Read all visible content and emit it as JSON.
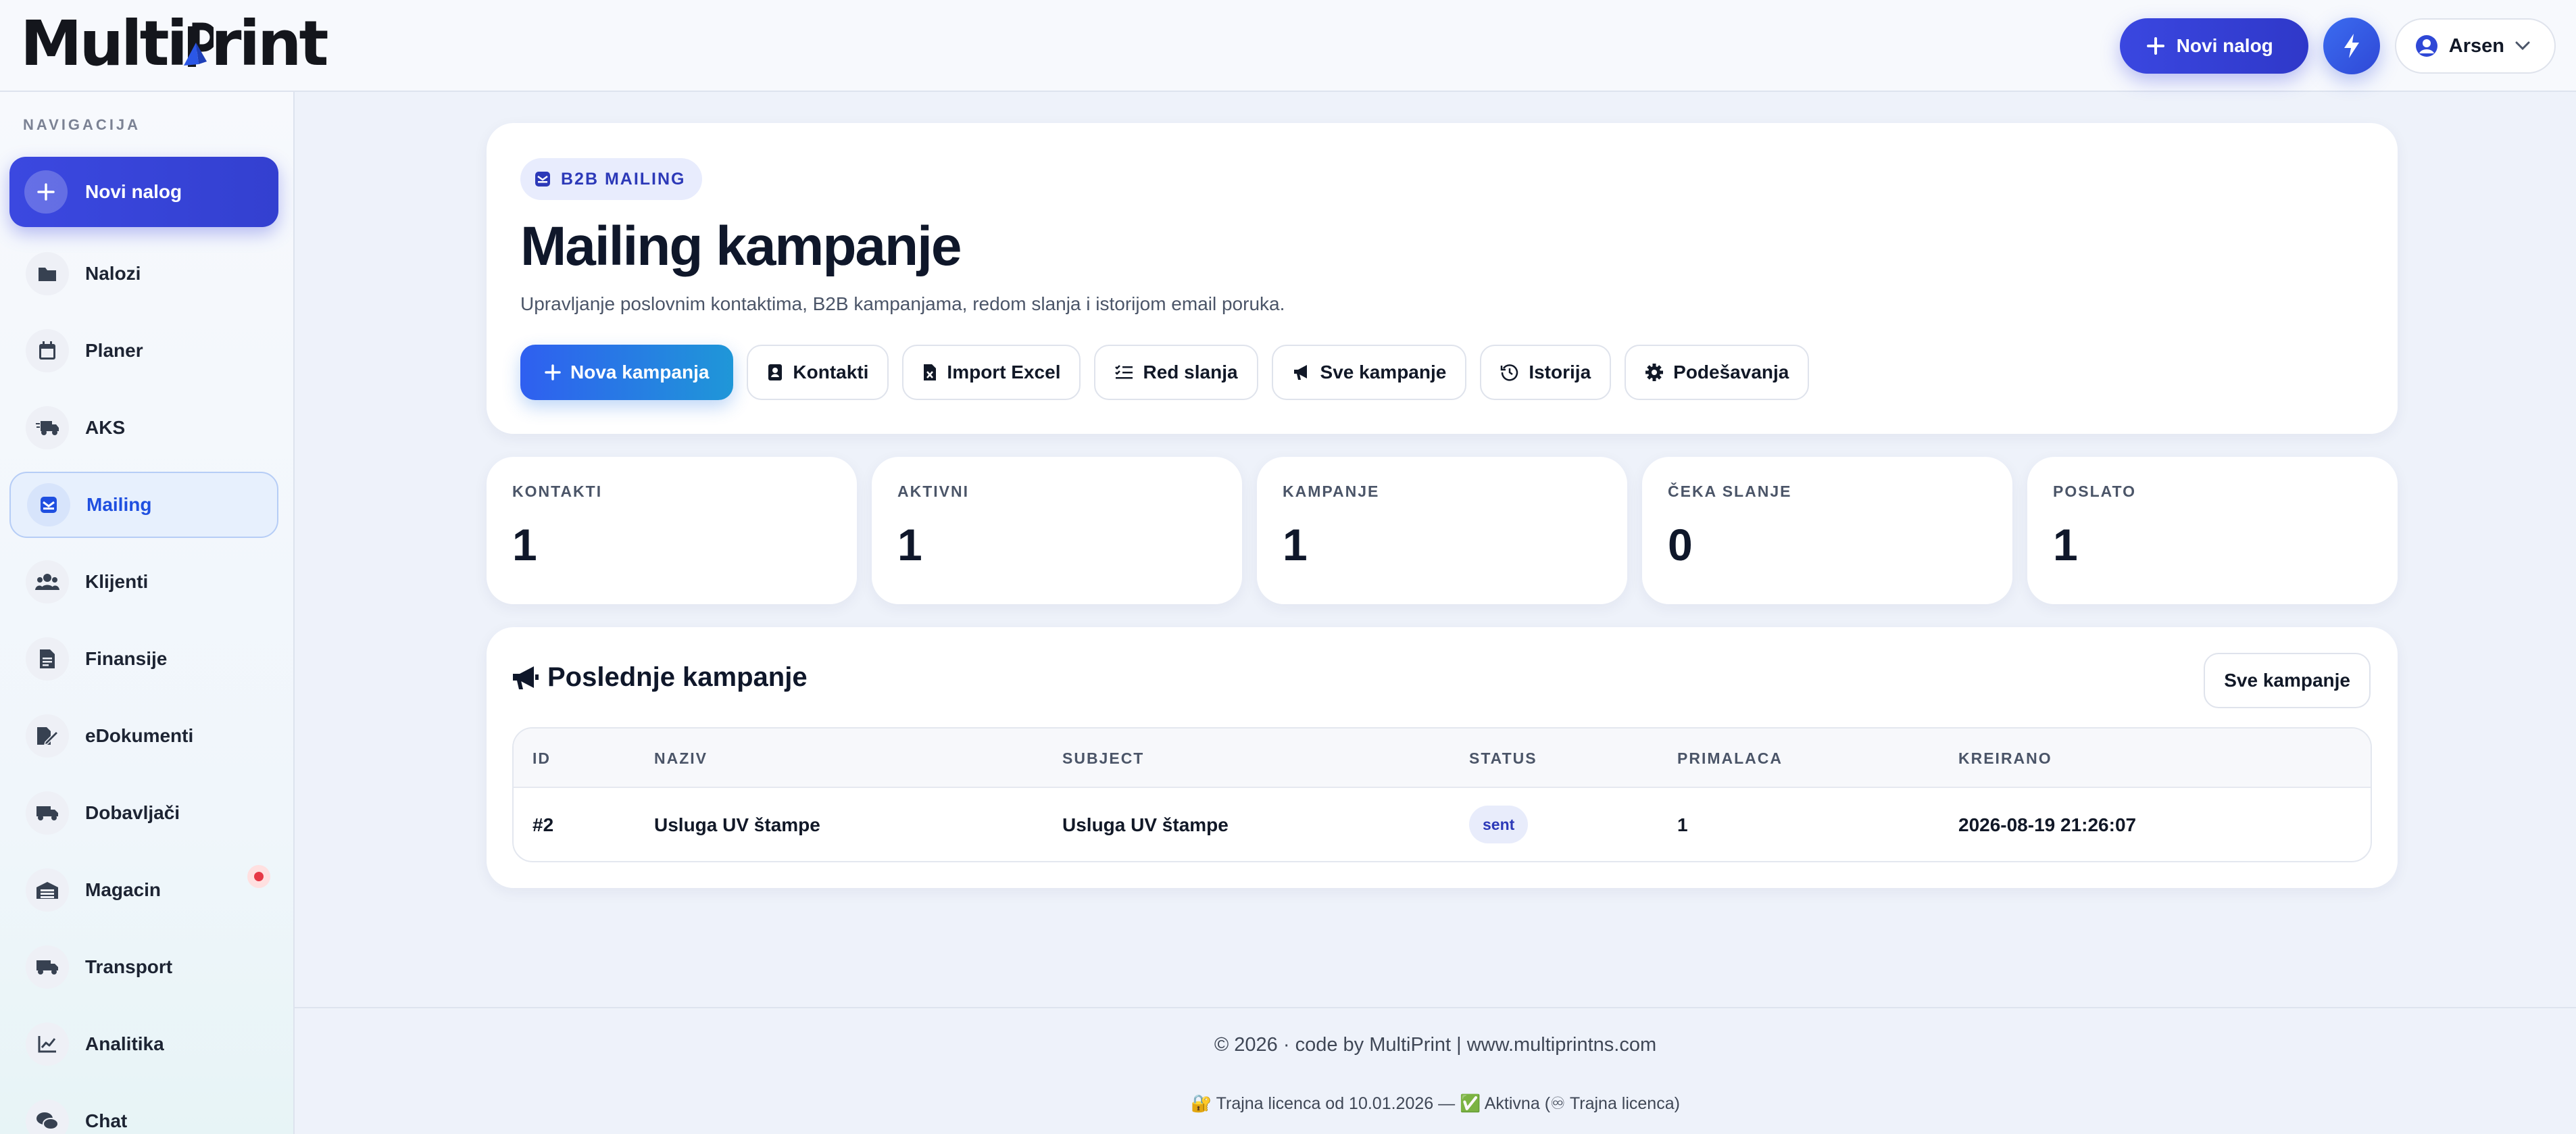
{
  "app": {
    "logo_text_left": "Multi",
    "logo_text_right": "rint"
  },
  "header": {
    "new_order_label": "Novi nalog",
    "user_name": "Arsen"
  },
  "sidebar": {
    "section_title": "NAVIGACIJA",
    "new_order_label": "Novi nalog",
    "items": [
      {
        "label": "Nalozi",
        "icon": "folder-icon"
      },
      {
        "label": "Planer",
        "icon": "calendar-icon"
      },
      {
        "label": "AKS",
        "icon": "truck-fast-icon"
      },
      {
        "label": "Mailing",
        "icon": "mail-bulk-icon",
        "active": true
      },
      {
        "label": "Klijenti",
        "icon": "users-icon"
      },
      {
        "label": "Finansije",
        "icon": "invoice-icon"
      },
      {
        "label": "eDokumenti",
        "icon": "file-signature-icon"
      },
      {
        "label": "Dobavljači",
        "icon": "truck-icon"
      },
      {
        "label": "Magacin",
        "icon": "warehouse-icon",
        "notification": true
      },
      {
        "label": "Transport",
        "icon": "truck-icon"
      },
      {
        "label": "Analitika",
        "icon": "line-chart-icon"
      },
      {
        "label": "Chat",
        "icon": "chat-icon"
      }
    ]
  },
  "hero": {
    "badge": "B2B MAILING",
    "title": "Mailing kampanje",
    "subtitle": "Upravljanje poslovnim kontaktima, B2B kampanjama, redom slanja i istorijom email poruka.",
    "actions": {
      "new_campaign": "Nova kampanja",
      "contacts": "Kontakti",
      "import_excel": "Import Excel",
      "queue": "Red slanja",
      "all_campaigns": "Sve kampanje",
      "history": "Istorija",
      "settings": "Podešavanja"
    }
  },
  "stats": [
    {
      "label": "KONTAKTI",
      "value": "1"
    },
    {
      "label": "AKTIVNI",
      "value": "1"
    },
    {
      "label": "KAMPANJE",
      "value": "1"
    },
    {
      "label": "ČEKA SLANJE",
      "value": "0"
    },
    {
      "label": "POSLATO",
      "value": "1"
    }
  ],
  "recent": {
    "title": "Poslednje kampanje",
    "all_button": "Sve kampanje",
    "columns": {
      "id": "ID",
      "name": "NAZIV",
      "subject": "SUBJECT",
      "status": "STATUS",
      "recipients": "PRIMALACA",
      "created": "KREIRANO"
    },
    "rows": [
      {
        "id": "#2",
        "name": "Usluga UV štampe",
        "subject": "Usluga UV štampe",
        "status": "sent",
        "recipients": "1",
        "created": "2026-08-19 21:26:07"
      }
    ]
  },
  "footer": {
    "copyright": "© 2026 · code by MultiPrint | www.multiprintns.com",
    "license": "🔐 Trajna licenca od 10.01.2026 — ✅ Aktivna (♾ Trajna licenca)"
  },
  "colors": {
    "accent": "#3a47e0",
    "accent_gradient_end": "#1f97d8",
    "active_nav": "#1f4fe0",
    "danger": "#e63946"
  }
}
